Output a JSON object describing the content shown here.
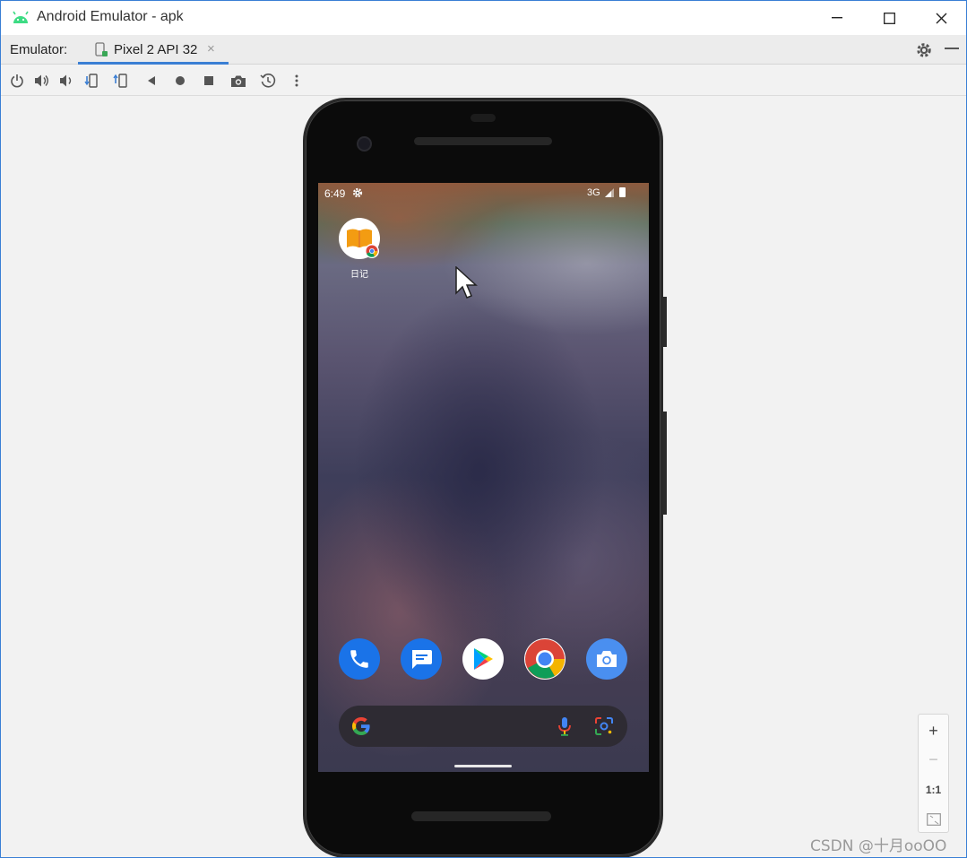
{
  "window": {
    "title": "Android Emulator - apk",
    "app_icon": "android-icon",
    "buttons": [
      "minimize",
      "maximize",
      "close"
    ]
  },
  "tabbar": {
    "label": "Emulator:",
    "tab_label": "Pixel 2 API 32",
    "tab_close": "×"
  },
  "toolbar": {
    "icons": [
      "power-icon",
      "volume-up-icon",
      "volume-down-icon",
      "rotate-left-icon",
      "rotate-right-icon",
      "back-icon",
      "home-icon",
      "overview-icon",
      "screenshot-icon",
      "snapshot-icon",
      "more-icon"
    ]
  },
  "device": {
    "status_time": "6:49",
    "status_network": "3G",
    "home_app_label": "日记",
    "dock": [
      "phone-icon",
      "messages-icon",
      "play-store-icon",
      "chrome-icon",
      "camera-icon"
    ]
  },
  "zoom": {
    "plus": "+",
    "minus": "−",
    "one_to_one": "1:1"
  },
  "watermark": "CSDN @十月ooOO",
  "colors": {
    "accent": "#3b7fd4",
    "android_green": "#3ddc84",
    "dock_blue": "#1a73e8"
  }
}
